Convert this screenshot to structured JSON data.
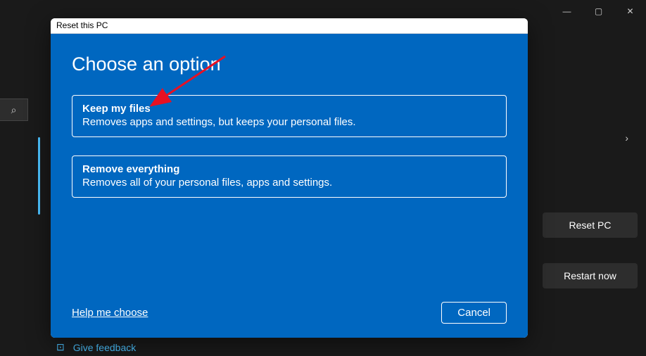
{
  "window": {
    "minimize": "—",
    "maximize": "▢",
    "close": "✕"
  },
  "sidebar": {
    "search_icon": "⌕"
  },
  "background": {
    "reset_button": "Reset PC",
    "restart_button": "Restart now",
    "feedback_icon": "⊡",
    "feedback_label": "Give feedback",
    "chevron": "›"
  },
  "dialog": {
    "titlebar": "Reset this PC",
    "heading": "Choose an option",
    "options": [
      {
        "title": "Keep my files",
        "description": "Removes apps and settings, but keeps your personal files."
      },
      {
        "title": "Remove everything",
        "description": "Removes all of your personal files, apps and settings."
      }
    ],
    "help_link": "Help me choose",
    "cancel": "Cancel"
  }
}
